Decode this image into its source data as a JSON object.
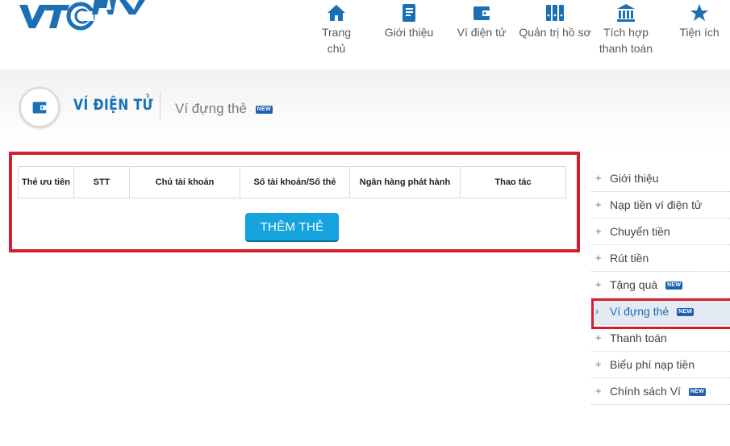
{
  "logo": {
    "text": "VTC Pay",
    "colors": {
      "primary": "#1b6fb5"
    }
  },
  "nav": [
    {
      "label": "Trang chủ",
      "icon": "home-icon"
    },
    {
      "label": "Giới thiệu",
      "icon": "book-icon"
    },
    {
      "label": "Ví điện tử",
      "icon": "wallet-icon"
    },
    {
      "label": "Quản trị hồ sơ",
      "icon": "binders-icon"
    },
    {
      "label_line1": "Tích hợp",
      "label_line2": "thanh toán",
      "icon": "bank-icon"
    },
    {
      "label": "Tiện ích",
      "icon": "star-icon"
    }
  ],
  "section": {
    "title": "VÍ ĐIỆN TỬ",
    "subtitle": "Ví đựng thẻ",
    "badge": "NEW",
    "icon": "wallet-icon"
  },
  "table": {
    "headers": [
      "Thẻ ưu tiên",
      "STT",
      "Chủ tài khoản",
      "Số tài khoản/Số thẻ",
      "Ngân hàng phát hành",
      "Thao tác"
    ],
    "rows": []
  },
  "add_button": "THÊM THẺ",
  "sidebar": [
    {
      "label": "Giới thiệu"
    },
    {
      "label": "Nạp tiền ví điện tử"
    },
    {
      "label": "Chuyển tiền"
    },
    {
      "label": "Rút tiền"
    },
    {
      "label": "Tặng quà",
      "badge": "NEW"
    },
    {
      "label": "Ví đựng thẻ",
      "badge": "NEW",
      "active": true
    },
    {
      "label": "Thanh toán"
    },
    {
      "label": "Biểu phí nạp tiền"
    },
    {
      "label": "Chính sách Ví",
      "badge": "NEW"
    }
  ],
  "colors": {
    "accent": "#1672b6",
    "highlight": "#d4202e",
    "button": "#16a4de"
  }
}
